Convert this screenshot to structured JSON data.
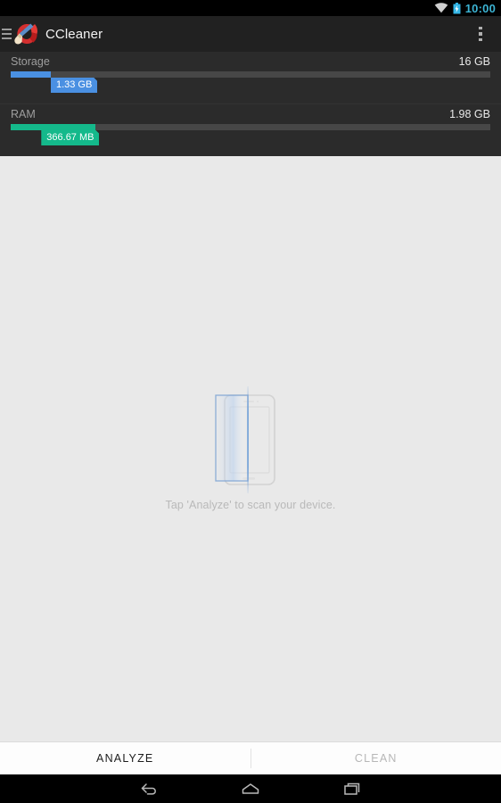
{
  "status_bar": {
    "clock": "10:00",
    "clock_color": "#3cb4d4",
    "wifi_icon": "wifi-icon",
    "battery_icon": "battery-charging-icon",
    "battery_color": "#33b5e5"
  },
  "action_bar": {
    "menu_icon": "hamburger-menu-icon",
    "logo_icon": "ccleaner-logo-icon",
    "title": "CCleaner",
    "overflow_icon": "overflow-menu-icon",
    "background": "#212121"
  },
  "meters": [
    {
      "id": "storage",
      "label": "Storage",
      "total": "16 GB",
      "used_label": "1.33 GB",
      "percent": 8.3,
      "badge_left_pct": 8.0,
      "color": "#4a90e2",
      "track_color": "#474747"
    },
    {
      "id": "ram",
      "label": "RAM",
      "total": "1.98 GB",
      "used_label": "366.67 MB",
      "percent": 17.6,
      "badge_left_pct": 6.1,
      "color": "#14b98b",
      "track_color": "#474747"
    }
  ],
  "main": {
    "illustration_icon": "phone-scan-illustration-icon",
    "hint": "Tap 'Analyze' to scan your device.",
    "background": "#e9e9e9"
  },
  "tabs": [
    {
      "id": "analyze",
      "label": "ANALYZE",
      "active": true
    },
    {
      "id": "clean",
      "label": "CLEAN",
      "active": false
    }
  ],
  "nav_bar": {
    "back_icon": "back-arrow-icon",
    "home_icon": "home-icon",
    "recents_icon": "recent-apps-icon"
  }
}
